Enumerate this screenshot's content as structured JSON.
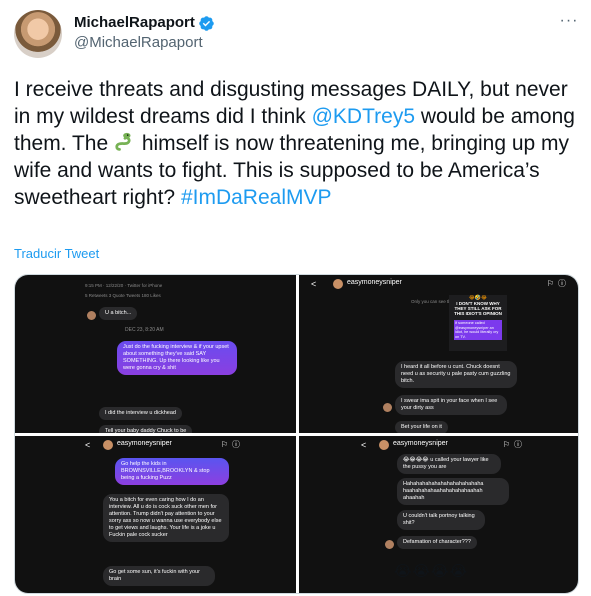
{
  "tweet": {
    "display_name": "MichaelRapaport",
    "handle": "@MichaelRapaport",
    "more_icon": "more-horizontal-icon",
    "text_part1": "I receive threats and disgusting messages DAILY, but never in my wildest dreams did I think ",
    "mention": "@KDTrey5",
    "text_part2": " would be among them. The ",
    "emoji": "snake-emoji",
    "text_part3": " himself is now threatening me, bringing up my wife and wants to fight. This is supposed to be America’s sweetheart right?",
    "hashtag": "#ImDaRealMVP",
    "translate_label": "Traducir Tweet"
  },
  "colors": {
    "link": "#1d9bf0",
    "verified": "#1d9bf0",
    "dm_bg": "#111111",
    "bubble_purple": "#7a45ea",
    "bubble_gray": "#2a2a2c"
  },
  "media": {
    "tile1": {
      "meta": "9:15 PM · 12/22/20 · Twitter for iPhone",
      "stats": "5 Retweets   3 Quote Tweets   180 Likes",
      "msg1": "U a bitch...",
      "date": "DEC 23, 8:20 AM",
      "msg2": "Just do the fucking interview & if your upset about something they've said SAY SOMETHING. Up there looking like you were gonna cry & shit",
      "msg3": "I did the interview u dickhead",
      "msg4": "Tell your baby daddy Chuck to be"
    },
    "tile2": {
      "name": "easymoneysniper",
      "reply_label": "Only you can see this",
      "story_top": "😂🤣😂",
      "story_line1": "I DON'T KNOW WHY",
      "story_line2": "THEY STILL ASK FOR",
      "story_line3": "THIS IDIOT'S OPINION",
      "story_box": "If someone called @easymoneysniper an idiot, he would literally cry on TV.",
      "msg1": "I heard it all before u cunt. Chuck doesnt need u as security u pale pasty cum guzzling bitch.",
      "msg2": "I swear ima spit in your face when I see your dirty ass",
      "msg3": "Bet your life on it"
    },
    "tile3": {
      "name": "easymoneysniper",
      "msg1": "Go help the kids in BROWNSVILLE,BROOKLYN & stop being a fucking Puzz",
      "msg2": "You a bitch for even caring how I do an interview. All u do is cock suck other men for attention. Trump didn't pay attention to your sorry ass so now u wanna use everybody else to get views and laughs. Your life is a joke u Fuckin pale cock sucker",
      "msg3": "Go get some sun, it's fuckin with your brain"
    },
    "tile4": {
      "name": "easymoneysniper",
      "msg1": "😂😂😂😂 u called your lawyer like the pussy you are",
      "msg2": "Hahahahahahahahahahahahaha haahahahahaahahahahahaahah ahaahah",
      "msg3": "U couldn't talk portnoy talking shit?",
      "msg4": "Defamation of character???",
      "emojis": "😭😭😭😭"
    }
  }
}
